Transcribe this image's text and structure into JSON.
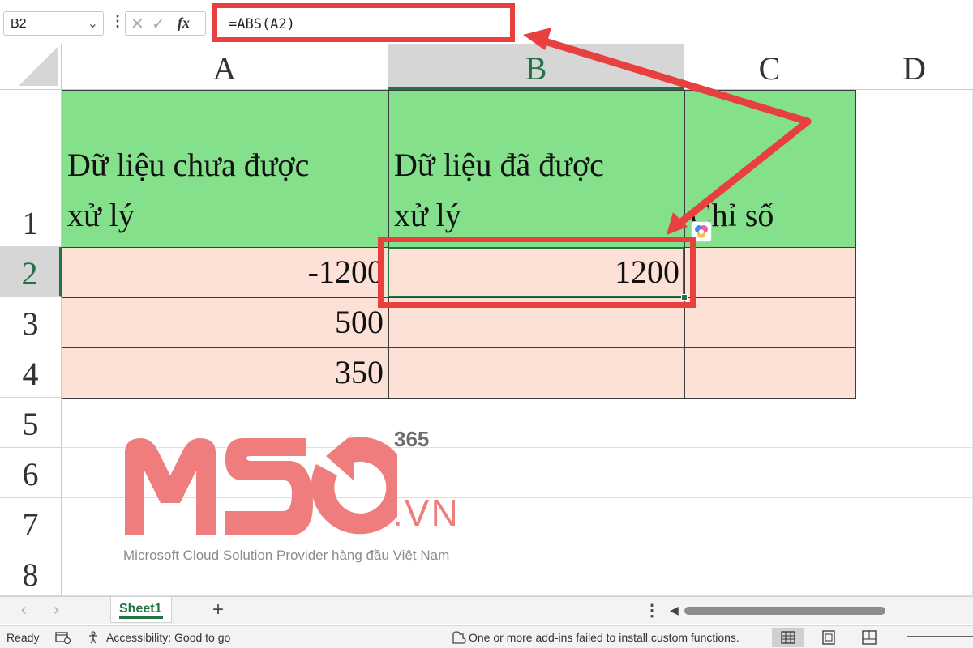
{
  "formula_bar": {
    "name_box": "B2",
    "formula": "=ABS(A2)"
  },
  "columns": [
    "A",
    "B",
    "C",
    "D"
  ],
  "rows": [
    "1",
    "2",
    "3",
    "4",
    "5",
    "6",
    "7",
    "8"
  ],
  "cells": {
    "A1_line1": "Dữ liệu chưa được",
    "A1_line2": "xử lý",
    "B1_line1": "Dữ liệu đã được",
    "B1_line2": "xử lý",
    "C1": "Chỉ số",
    "A2": "-1200",
    "B2": "1200",
    "A3": "500",
    "A4": "350"
  },
  "watermark": {
    "number": "365",
    "domain": ".VN",
    "tagline": "Microsoft Cloud Solution Provider hàng đầu Việt Nam"
  },
  "sheet_tabs": {
    "active": "Sheet1",
    "add_label": "+"
  },
  "status_bar": {
    "ready": "Ready",
    "accessibility": "Accessibility: Good to go",
    "addins": "One or more add-ins failed to install custom functions."
  },
  "colors": {
    "header_fill": "#85e08c",
    "data_fill": "#fde1d6",
    "highlight_red": "#e8403f",
    "excel_green": "#217346"
  },
  "icons": [
    "chevron-down-icon",
    "cancel-icon",
    "enter-icon",
    "function-icon",
    "copilot-icon",
    "macro-icon",
    "accessibility-icon",
    "addins-icon",
    "normal-view-icon",
    "page-layout-icon",
    "page-break-icon"
  ]
}
